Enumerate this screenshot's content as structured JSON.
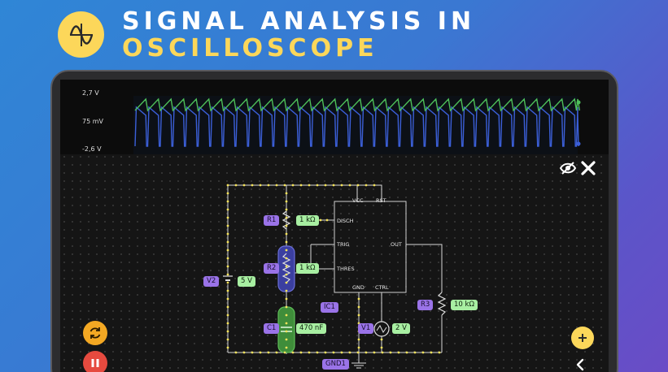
{
  "header": {
    "title_line1": "SIGNAL ANALYSIS IN",
    "title_line2": "OSCILLOSCOPE",
    "icon": "sine-wave-icon"
  },
  "oscilloscope": {
    "max_label": "2,7 V",
    "mid_label": "75 mV",
    "min_label": "-2,6 V",
    "series": [
      {
        "color": "#4ec05a",
        "shape": "sawtooth-rising"
      },
      {
        "color": "#3b5fd8",
        "shape": "sawtooth-falling"
      }
    ]
  },
  "toolbar": {
    "visibility_icon": "eye-slash-icon",
    "close_icon": "close-icon"
  },
  "components": {
    "r1": {
      "name": "R1",
      "value": "1 kΩ"
    },
    "r2": {
      "name": "R2",
      "value": "1 kΩ"
    },
    "r3": {
      "name": "R3",
      "value": "10 kΩ"
    },
    "c1": {
      "name": "C1",
      "value": "470 nF"
    },
    "v1": {
      "name": "V1",
      "value": "2 V"
    },
    "v2": {
      "name": "V2",
      "value": "5 V"
    },
    "ic1": {
      "name": "IC1"
    },
    "gnd1": {
      "name": "GND1"
    }
  },
  "ic_pins": {
    "vcc": "VCC",
    "rst": "RST",
    "disch": "DISCH",
    "trig": "TRIG",
    "out": "OUT",
    "thres": "THRES",
    "gnd": "GND",
    "ctrl": "CTRL"
  },
  "buttons": {
    "rotate_icon": "rotate-icon",
    "pause_icon": "pause-icon",
    "add_icon": "plus-icon",
    "back_icon": "chevron-left-icon"
  },
  "colors": {
    "accent_yellow": "#fcd75a",
    "trace_green": "#4ec05a",
    "trace_blue": "#3b5fd8",
    "selection_green": "#a8efa2",
    "selection_purple": "#9a73e8",
    "pause_red": "#e64a3f"
  }
}
